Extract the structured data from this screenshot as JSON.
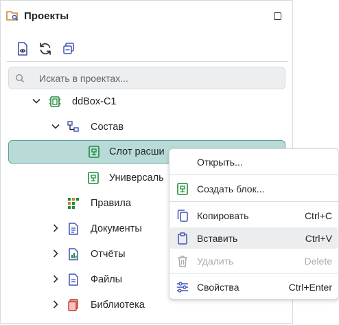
{
  "panel": {
    "title": "Проекты",
    "search_placeholder": "Искать в проектах..."
  },
  "tree": [
    {
      "label": "ddBox-C1",
      "icon": "board-icon"
    },
    {
      "label": "Состав",
      "icon": "structure-icon"
    },
    {
      "label": "Слот расши",
      "icon": "block-icon",
      "selected": true
    },
    {
      "label": "Универсаль",
      "icon": "block-icon"
    },
    {
      "label": "Правила",
      "icon": "rules-icon"
    },
    {
      "label": "Документы",
      "icon": "documents-icon"
    },
    {
      "label": "Отчёты",
      "icon": "reports-icon"
    },
    {
      "label": "Файлы",
      "icon": "file-icon"
    },
    {
      "label": "Библиотека",
      "icon": "library-icon"
    }
  ],
  "context_menu": {
    "open": {
      "label": "Открыть..."
    },
    "create_block": {
      "label": "Создать блок..."
    },
    "copy": {
      "label": "Копировать",
      "shortcut": "Ctrl+C"
    },
    "paste": {
      "label": "Вставить",
      "shortcut": "Ctrl+V"
    },
    "delete": {
      "label": "Удалить",
      "shortcut": "Delete"
    },
    "properties": {
      "label": "Свойства",
      "shortcut": "Ctrl+Enter"
    }
  },
  "colors": {
    "accent": "#1e8a3c",
    "selection": "#b8dbd8",
    "selection_border": "#5f9e99",
    "doc_icon": "#3f51b5",
    "library_icon": "#c0392b"
  }
}
